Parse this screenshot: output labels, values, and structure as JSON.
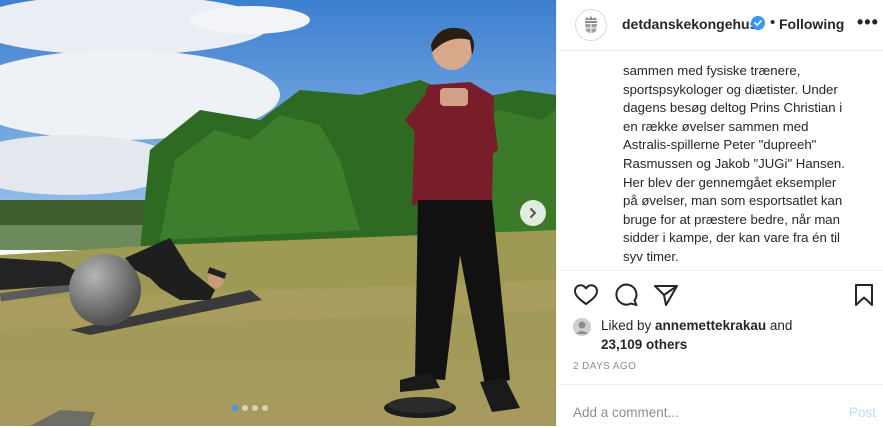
{
  "header": {
    "username": "detdanskekongehus",
    "separator": "•",
    "follow_status": "Following",
    "more_label": "•••"
  },
  "caption": {
    "lines": [
      "sammen med fysiske trænere,",
      "sportspsykologer og diætister. Under",
      "dagens besøg deltog Prins Christian i",
      "en række øvelser sammen med",
      "Astralis-spillerne Peter \"dupreeh\"",
      "Rasmussen og Jakob \"JUGi\" Hansen.",
      "Her blev der gennemgået eksempler",
      "på øvelser, man som esportsatlet kan",
      "bruge for at præstere bedre, når man",
      "sidder i kampe, der kan vare fra én til",
      "syv timer."
    ]
  },
  "likes": {
    "prefix": "Liked by ",
    "liker": "annemettekrakau",
    "conj": " and",
    "count": "23,109 others"
  },
  "time_ago": "2 DAYS AGO",
  "comment": {
    "placeholder": "Add a comment...",
    "post_label": "Post"
  },
  "carousel": {
    "slide_count": 4,
    "active_index": 0
  },
  "colors": {
    "accent": "#3897f0",
    "verified": "#3897f0",
    "post_disabled": "#b2dffc"
  }
}
